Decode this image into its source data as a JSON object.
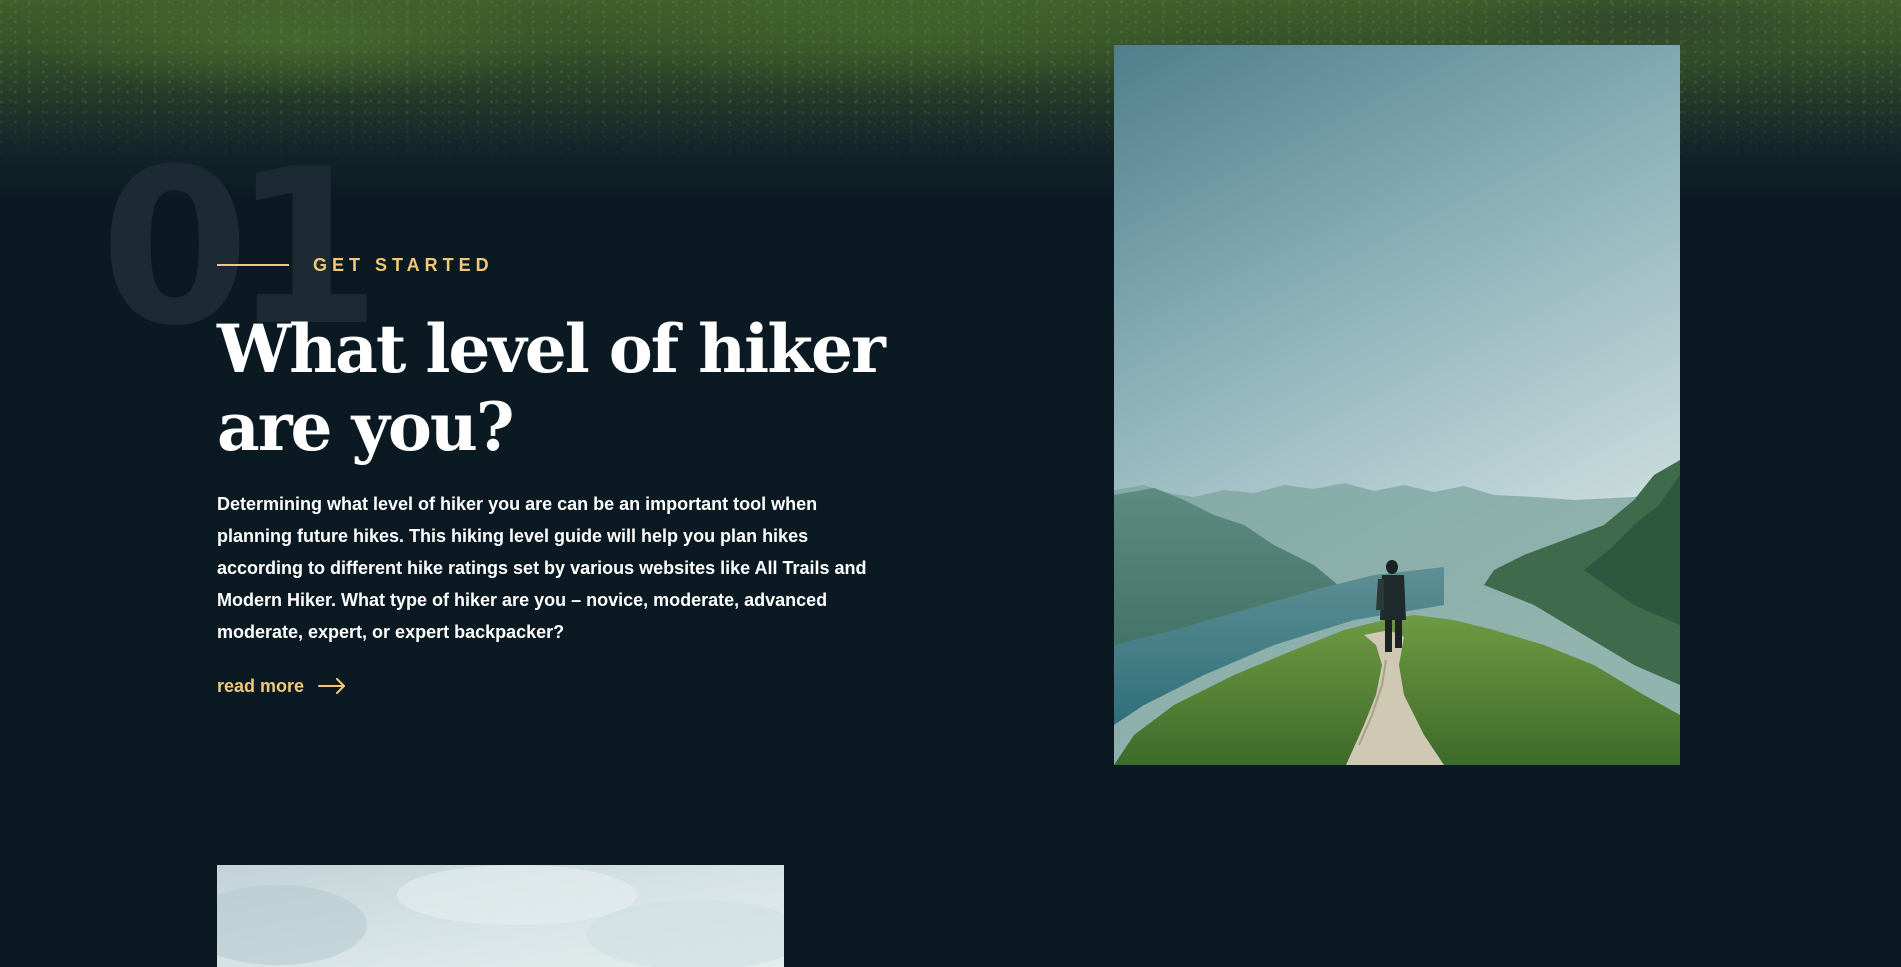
{
  "section": {
    "number": "01",
    "eyebrow": "GET STARTED",
    "title": "What level of hiker are you?",
    "body": "Determining what level of hiker you are can be an important tool when planning future hikes. This hiking level guide will help you plan hikes according to different hike ratings set by various websites like All Trails and Modern Hiker. What type of hiker are you – novice, moderate, advanced moderate, expert, or expert backpacker?",
    "read_more_label": "read more",
    "read_more_icon": "arrow-right-icon"
  },
  "images": {
    "feature_photo": "hiker-on-mountain-ridge",
    "next_section_photo": "cloudy-sky"
  },
  "colors": {
    "background": "#0b1a22",
    "accent": "#f0c878",
    "number_watermark": "#1c2b33",
    "text": "#ffffff"
  }
}
